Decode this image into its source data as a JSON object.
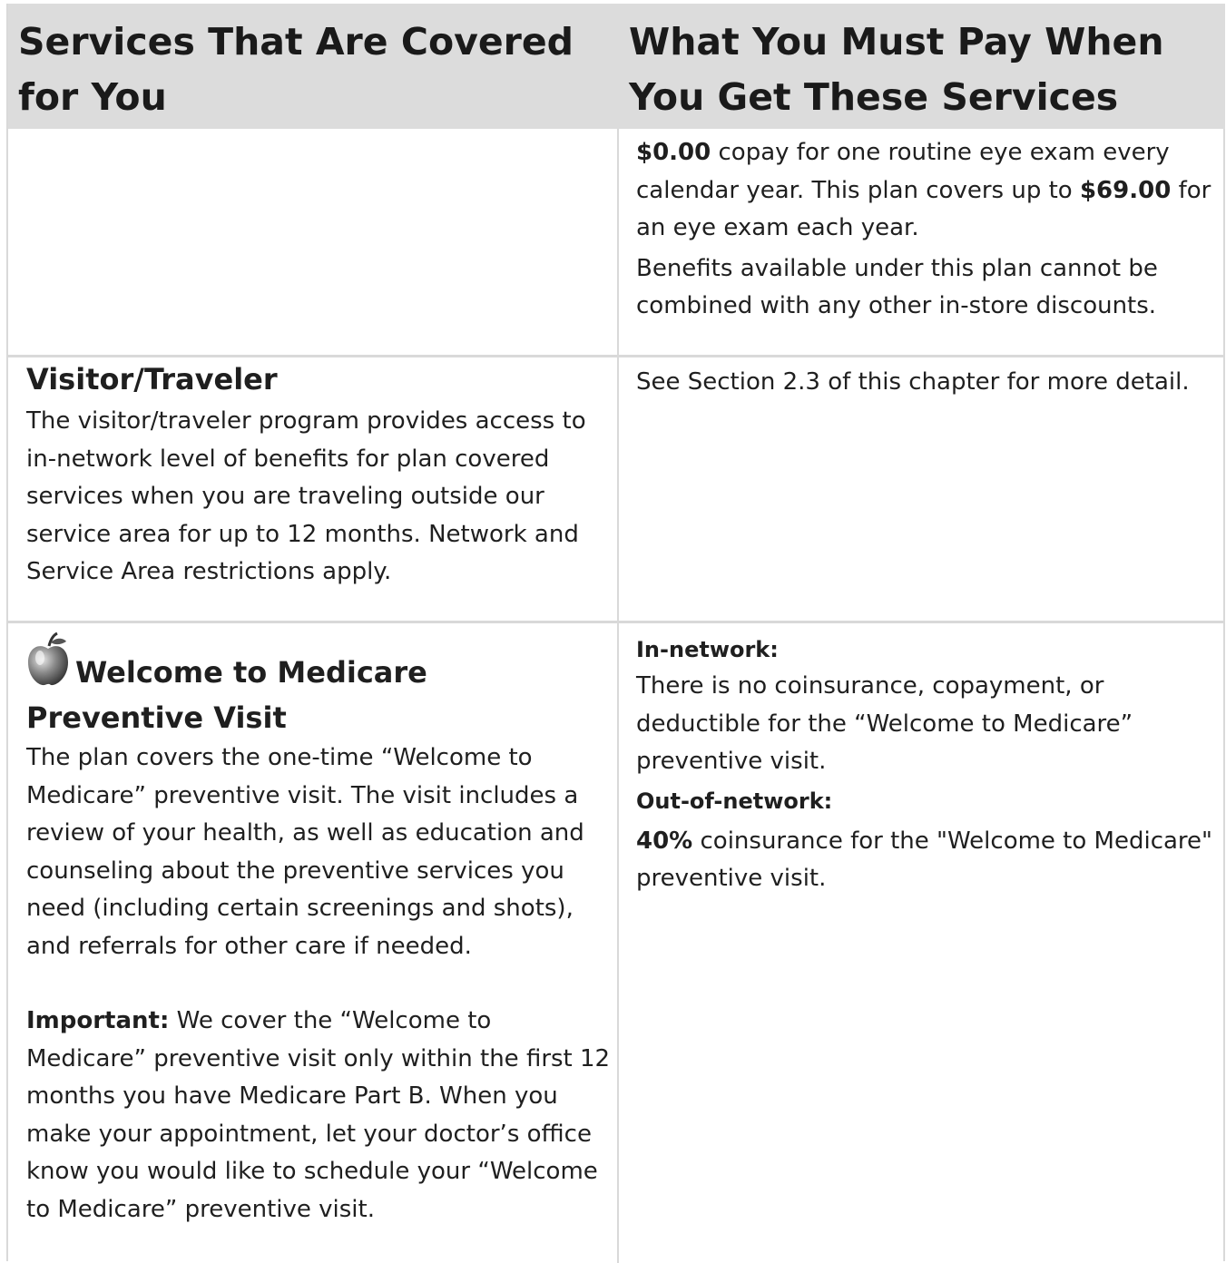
{
  "header": {
    "col1": "Services That Are Covered for You",
    "col2": "What You Must Pay When You Get These Services"
  },
  "row1": {
    "amount_exam": "$0.00",
    "text_exam": " copay for one routine eye exam every calendar year.  This plan covers up to ",
    "amount_cap": "$69.00",
    "text_cap": " for an eye exam each year.",
    "note": "Benefits available under this plan cannot be combined with any other in-store discounts."
  },
  "row2": {
    "title": "Visitor/Traveler",
    "description": "The visitor/traveler program provides access to in-network level of benefits for plan covered services when you are traveling outside our service area for up to 12 months. Network and Service Area restrictions apply.",
    "cost": "See Section 2.3 of this chapter for more detail."
  },
  "row3": {
    "icon": "apple-icon",
    "title": "Welcome to Medicare Preventive Visit",
    "description": "The plan covers the one-time “Welcome to Medicare” preventive visit. The visit includes a review of your health, as well as education and counseling about the preventive services you need (including certain screenings and shots), and referrals for other care if needed.",
    "important_label": "Important:",
    "important_text": " We cover the “Welcome to Medicare” preventive visit only within the first 12 months you have Medicare Part B. When you make your appointment, let your doctor’s office know you would like to schedule your “Welcome to Medicare” preventive visit.",
    "in_network_label": "In-network:",
    "in_network_text": "There is no coinsurance, copayment, or deductible for the “Welcome to Medicare” preventive visit.",
    "out_network_label": "Out-of-network:",
    "out_network_amount": "40%",
    "out_network_text": " coinsurance for the \"Welcome to Medicare\" preventive visit."
  }
}
